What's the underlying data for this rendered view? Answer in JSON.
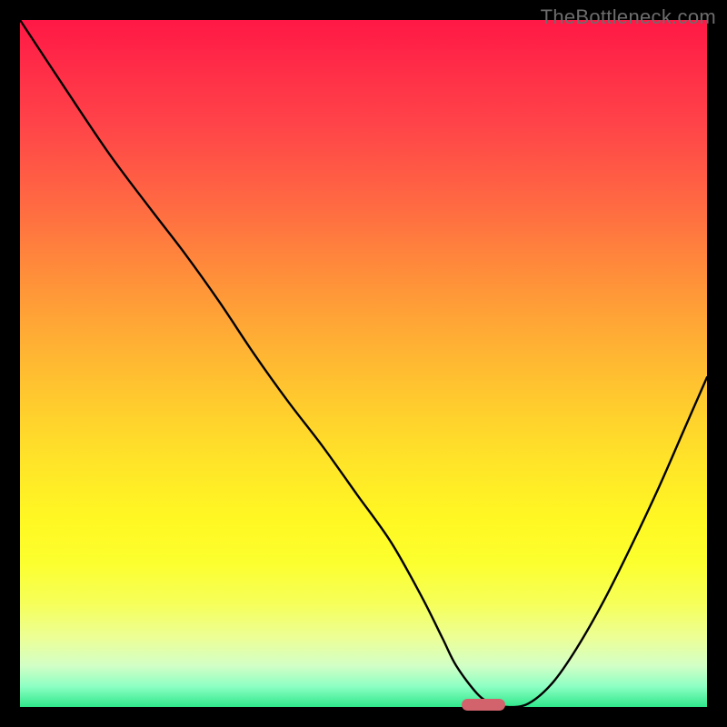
{
  "watermark": "TheBottleneck.com",
  "chart_data": {
    "type": "line",
    "title": "",
    "xlabel": "",
    "ylabel": "",
    "xlim": [
      0,
      100
    ],
    "ylim": [
      0,
      100
    ],
    "grid": false,
    "series": [
      {
        "name": "bottleneck-curve",
        "x": [
          0,
          6.6,
          13,
          19,
          24,
          29,
          34,
          39,
          44,
          49,
          54,
          58.5,
          61.5,
          63.5,
          66.5,
          68.5,
          71,
          74,
          77.5,
          81,
          85,
          89,
          93,
          96.5,
          100
        ],
        "y": [
          100,
          90,
          80.5,
          72.5,
          66,
          59,
          51.5,
          44.5,
          38,
          31,
          24,
          16,
          10,
          6,
          2,
          0.6,
          0,
          0.5,
          3.5,
          8.5,
          15.5,
          23.5,
          32,
          40,
          48
        ]
      }
    ],
    "background_gradient": {
      "top": "#ff1846",
      "upper_mid": "#ffb034",
      "mid": "#fff823",
      "lower_mid": "#ecff97",
      "bottom": "#2fe88b"
    },
    "marker": {
      "x_center": 67.5,
      "y": 0,
      "color": "#d2636c"
    }
  }
}
